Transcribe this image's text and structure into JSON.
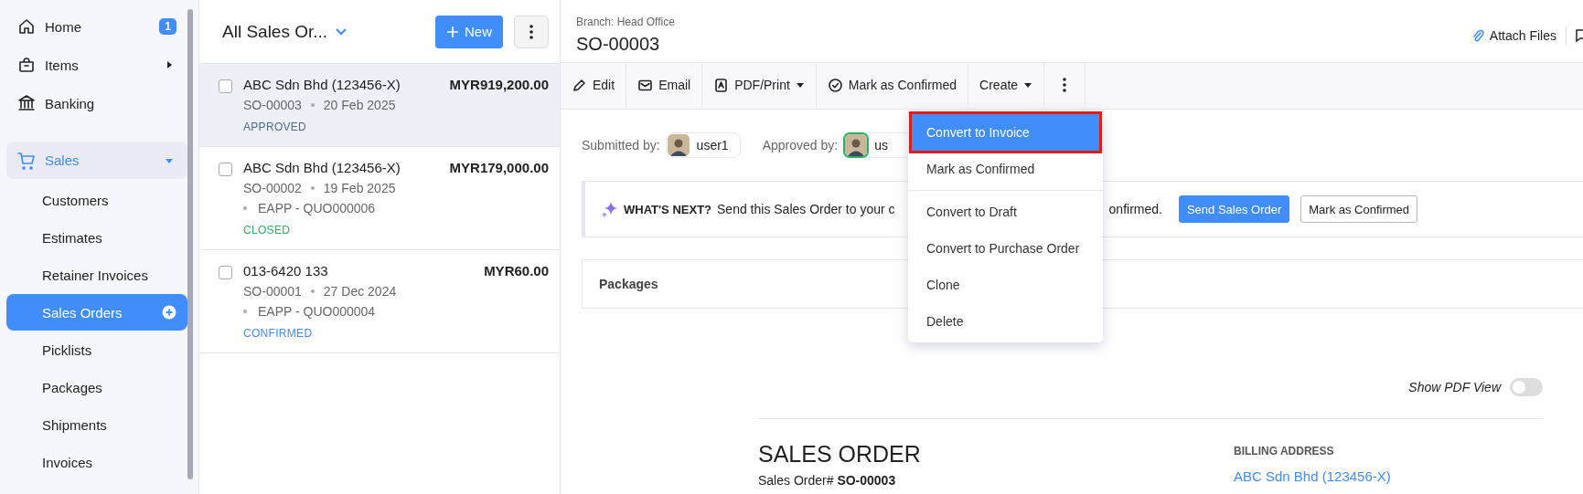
{
  "sidebar": {
    "items": [
      {
        "label": "Home",
        "selected": false,
        "badge": "1"
      },
      {
        "label": "Items",
        "selected": false,
        "expanded": false
      },
      {
        "label": "Banking",
        "selected": false
      },
      {
        "label": "Sales",
        "selected": true,
        "expanded": true,
        "children": [
          {
            "label": "Customers",
            "selected": false
          },
          {
            "label": "Estimates",
            "selected": false
          },
          {
            "label": "Retainer Invoices",
            "selected": false
          },
          {
            "label": "Sales Orders",
            "selected": true
          },
          {
            "label": "Picklists",
            "selected": false
          },
          {
            "label": "Packages",
            "selected": false
          },
          {
            "label": "Shipments",
            "selected": false
          },
          {
            "label": "Invoices",
            "selected": false
          }
        ]
      }
    ]
  },
  "list": {
    "title": "All Sales Or...",
    "new_button": "New",
    "orders": [
      {
        "customer": "ABC Sdn Bhd (123456-X)",
        "amount": "MYR919,200.00",
        "number": "SO-00003",
        "date": "20 Feb 2025",
        "status": "APPROVED",
        "color": "#4e6886",
        "selected": true,
        "checked": false
      },
      {
        "customer": "ABC Sdn Bhd (123456-X)",
        "amount": "MYR179,000.00",
        "number": "SO-00002",
        "date": "19 Feb 2025",
        "reference": "EAPP - QUO000006",
        "status": "CLOSED",
        "color": "#27b363",
        "selected": false,
        "checked": false
      },
      {
        "customer": "013-6420 133",
        "amount": "MYR60.00",
        "number": "SO-00001",
        "date": "27 Dec 2024",
        "reference": "EAPP - QUO000004",
        "status": "CONFIRMED",
        "color": "#408dfb",
        "selected": false,
        "checked": false
      }
    ]
  },
  "detail": {
    "branch": "Branch: Head Office",
    "title": "SO-00003",
    "attach": "Attach Files",
    "toolbar": [
      {
        "label": "Edit"
      },
      {
        "label": "Email"
      },
      {
        "label": "PDF/Print",
        "dropdown": true
      },
      {
        "label": "Mark as Confirmed"
      },
      {
        "label": "Create",
        "dropdown": true
      }
    ],
    "people": [
      {
        "label": "Submitted by:",
        "user": "user1",
        "kind": "submitter"
      },
      {
        "label": "Approved by:",
        "user": "us",
        "kind": "approver"
      }
    ],
    "whats_next": {
      "heading": "WHAT'S NEXT?",
      "text_start": "Send this Sales Order to your c",
      "text_end": "onfirmed.",
      "buttons": [
        {
          "label": "Send Sales Order",
          "kind": "primary"
        },
        {
          "label": "Mark as Confirmed",
          "kind": "secondary"
        }
      ]
    },
    "packages": {
      "title": "Packages"
    },
    "pdf_view": {
      "label": "Show PDF View",
      "on": false
    },
    "document": {
      "title": "SALES ORDER",
      "number": "Sales Order# **SO-00003**",
      "billing_heading": "BILLING ADDRESS",
      "billing_name": "ABC Sdn Bhd (123456-X)"
    }
  },
  "menu": {
    "groups": [
      [
        {
          "label": "Convert to Invoice",
          "selected": true
        },
        {
          "label": "Mark as Confirmed",
          "selected": false
        }
      ],
      [
        {
          "label": "Convert to Draft",
          "selected": false
        },
        {
          "label": "Convert to Purchase Order",
          "selected": false
        },
        {
          "label": "Clone",
          "selected": false
        },
        {
          "label": "Delete",
          "selected": false
        }
      ]
    ]
  }
}
